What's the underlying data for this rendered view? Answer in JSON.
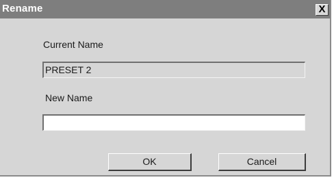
{
  "window": {
    "title": "Rename",
    "close_label": "X"
  },
  "form": {
    "current_name_label": "Current Name",
    "current_name_value": "PRESET 2",
    "new_name_label": "New Name",
    "new_name_value": ""
  },
  "buttons": {
    "ok_label": "OK",
    "cancel_label": "Cancel"
  }
}
